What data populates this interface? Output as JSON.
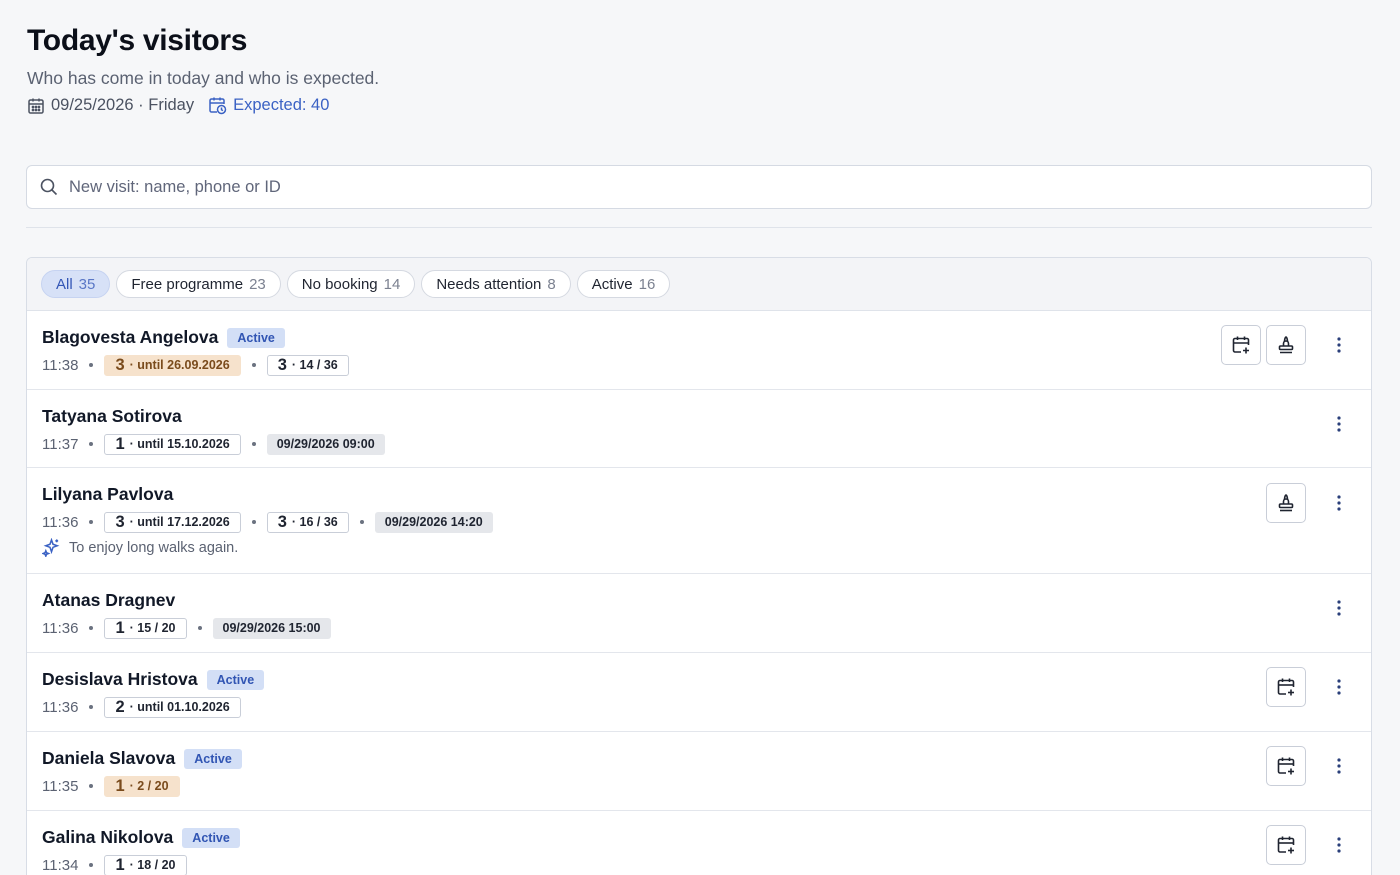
{
  "header": {
    "title": "Today's visitors",
    "subtitle": "Who has come in today and who is expected.",
    "date": "09/25/2026 · Friday",
    "expected": "Expected: 40"
  },
  "search": {
    "placeholder": "New visit: name, phone or ID",
    "value": ""
  },
  "filters": [
    {
      "label": "All",
      "count": "35",
      "selected": true
    },
    {
      "label": "Free programme",
      "count": "23"
    },
    {
      "label": "No booking",
      "count": "14"
    },
    {
      "label": "Needs attention",
      "count": "8"
    },
    {
      "label": "Active",
      "count": "16"
    }
  ],
  "status_label": "Active",
  "visitors": [
    {
      "name": "Blagovesta Angelova",
      "active": true,
      "time": "11:38",
      "pass1": {
        "num": "3",
        "text": "· until 26.09.2026",
        "warn": true
      },
      "pass2": {
        "num": "3",
        "text": "· 14 / 36"
      },
      "appointment": null,
      "goal": null,
      "actions": [
        "calendar-plus",
        "stamp"
      ]
    },
    {
      "name": "Tatyana Sotirova",
      "active": false,
      "time": "11:37",
      "pass1": {
        "num": "1",
        "text": "· until 15.10.2026"
      },
      "pass2": null,
      "appointment": "09/29/2026 09:00",
      "goal": null,
      "actions": []
    },
    {
      "name": "Lilyana Pavlova",
      "active": false,
      "time": "11:36",
      "pass1": {
        "num": "3",
        "text": "· until 17.12.2026"
      },
      "pass2": {
        "num": "3",
        "text": "· 16 / 36"
      },
      "appointment": "09/29/2026 14:20",
      "goal": "To enjoy long walks again.",
      "actions": [
        "stamp"
      ]
    },
    {
      "name": "Atanas Dragnev",
      "active": false,
      "time": "11:36",
      "pass1": {
        "num": "1",
        "text": "· 15 / 20"
      },
      "pass2": null,
      "appointment": "09/29/2026 15:00",
      "goal": null,
      "actions": []
    },
    {
      "name": "Desislava Hristova",
      "active": true,
      "time": "11:36",
      "pass1": {
        "num": "2",
        "text": "· until 01.10.2026"
      },
      "pass2": null,
      "appointment": null,
      "goal": null,
      "actions": [
        "calendar-plus"
      ]
    },
    {
      "name": "Daniela Slavova",
      "active": true,
      "time": "11:35",
      "pass1": {
        "num": "1",
        "text": "· 2 / 20",
        "warn": true
      },
      "pass2": null,
      "appointment": null,
      "goal": null,
      "actions": [
        "calendar-plus"
      ]
    },
    {
      "name": "Galina Nikolova",
      "active": true,
      "time": "11:34",
      "pass1": {
        "num": "1",
        "text": "· 18 / 20"
      },
      "pass2": null,
      "appointment": null,
      "goal": null,
      "actions": [
        "calendar-plus"
      ]
    }
  ],
  "colors": {
    "accent": "#3b62c4",
    "active_badge_bg": "#d3dff6",
    "warn_pass_bg": "#f6e2cc"
  }
}
